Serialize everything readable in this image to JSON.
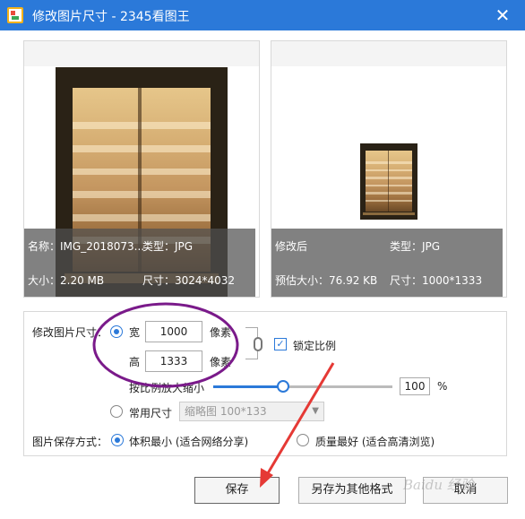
{
  "window": {
    "title": "修改图片尺寸 - 2345看图王",
    "close_glyph": "✕"
  },
  "source_info": {
    "name": "名称：IMG_2018073...",
    "type": "类型：JPG",
    "size": "大小：2.20 MB",
    "dimensions": "尺寸：3024*4032"
  },
  "result_info": {
    "label": "修改后",
    "type": "类型：JPG",
    "est_size": "预估大小：76.92 KB",
    "dimensions": "尺寸：1000*1333"
  },
  "resize": {
    "section_label": "修改图片尺寸：",
    "width_label": "宽",
    "width_value": "1000",
    "height_label": "高",
    "height_value": "1333",
    "unit": "像素",
    "lock_ratio_label": "锁定比例",
    "lock_ratio_checked": true,
    "scale_label": "按比例放大缩小",
    "scale_value": "100",
    "scale_unit": "%",
    "scale_fraction": 0.39,
    "common_size_label": "常用尺寸",
    "common_size_selected": "缩略图 100*133"
  },
  "save_mode": {
    "label": "图片保存方式：",
    "option_small": "体积最小 (适合网络分享)",
    "option_quality": "质量最好 (适合高清浏览)"
  },
  "buttons": {
    "save": "保存",
    "save_other": "另存为其他格式",
    "cancel": "取消"
  },
  "watermark": "Baidu 经验",
  "colors": {
    "accent": "#2b79d9",
    "annotation": "#7a1a8a",
    "arrow": "#e53935"
  }
}
